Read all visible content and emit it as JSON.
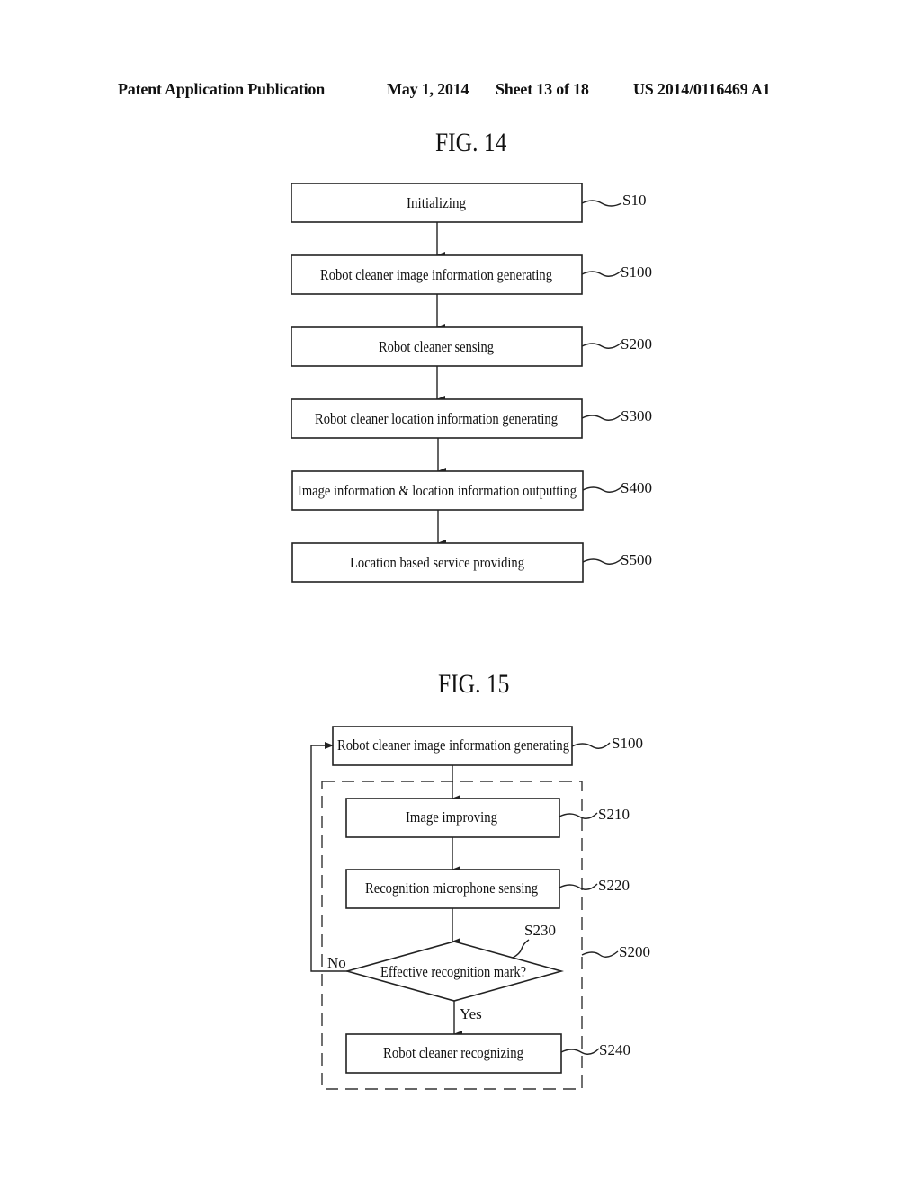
{
  "header": {
    "publication": "Patent Application Publication",
    "date": "May 1, 2014",
    "sheet": "Sheet 13 of 18",
    "patent_number": "US 2014/0116469 A1"
  },
  "fig14": {
    "title": "FIG. 14",
    "steps": [
      {
        "label": "Initializing",
        "ref": "S10"
      },
      {
        "label": "Robot cleaner image information generating",
        "ref": "S100"
      },
      {
        "label": "Robot cleaner sensing",
        "ref": "S200"
      },
      {
        "label": "Robot cleaner location information generating",
        "ref": "S300"
      },
      {
        "label": "Image information & location information outputting",
        "ref": "S400"
      },
      {
        "label": "Location based service providing",
        "ref": "S500"
      }
    ]
  },
  "fig15": {
    "title": "FIG. 15",
    "top_step": {
      "label": "Robot cleaner image information generating",
      "ref": "S100"
    },
    "group_ref": "S200",
    "steps": [
      {
        "label": "Image improving",
        "ref": "S210"
      },
      {
        "label": "Recognition microphone sensing",
        "ref": "S220"
      }
    ],
    "decision": {
      "label": "Effective recognition mark?",
      "ref": "S230",
      "no_label": "No",
      "yes_label": "Yes"
    },
    "final_step": {
      "label": "Robot cleaner recognizing",
      "ref": "S240"
    }
  }
}
